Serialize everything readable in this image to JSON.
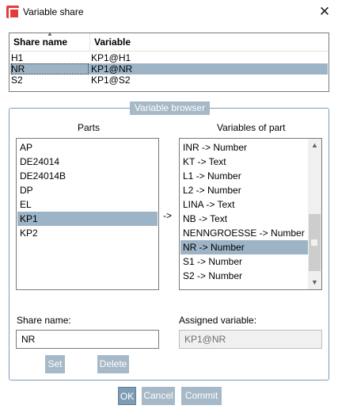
{
  "window": {
    "title": "Variable share",
    "close_glyph": "✕",
    "app_icon": "app-icon"
  },
  "share_table": {
    "columns": [
      "Share name",
      "Variable"
    ],
    "sort_glyph": "▲",
    "rows": [
      {
        "name": "H1",
        "variable": "KP1@H1",
        "selected": false
      },
      {
        "name": "NR",
        "variable": "KP1@NR",
        "selected": true
      },
      {
        "name": "S2",
        "variable": "KP1@S2",
        "selected": false
      }
    ]
  },
  "variable_browser": {
    "title": "Variable browser",
    "parts_label": "Parts",
    "variables_label": "Variables of part",
    "arrow": "->",
    "parts": [
      "AP",
      "DE24014",
      "DE24014B",
      "DP",
      "EL",
      "KP1",
      "KP2"
    ],
    "selected_part": "KP1",
    "variables": [
      "INR -> Number",
      "KT -> Text",
      "L1 -> Number",
      "L2 -> Number",
      "LINA -> Text",
      "NB -> Text",
      "NENNGROESSE -> Number",
      "NR -> Number",
      "S1 -> Number",
      "S2 -> Number"
    ],
    "selected_variable": "NR -> Number",
    "share_name_label": "Share name:",
    "share_name_value": "NR",
    "assigned_variable_label": "Assigned variable:",
    "assigned_variable_value": "KP1@NR",
    "set_label": "Set",
    "delete_label": "Delete"
  },
  "footer": {
    "ok_label": "OK",
    "cancel_label": "Cancel",
    "commit_label": "Commit"
  },
  "colors": {
    "selection": "#9db4c6",
    "button": "#a6b9c8",
    "brand": "#e23b3b"
  }
}
